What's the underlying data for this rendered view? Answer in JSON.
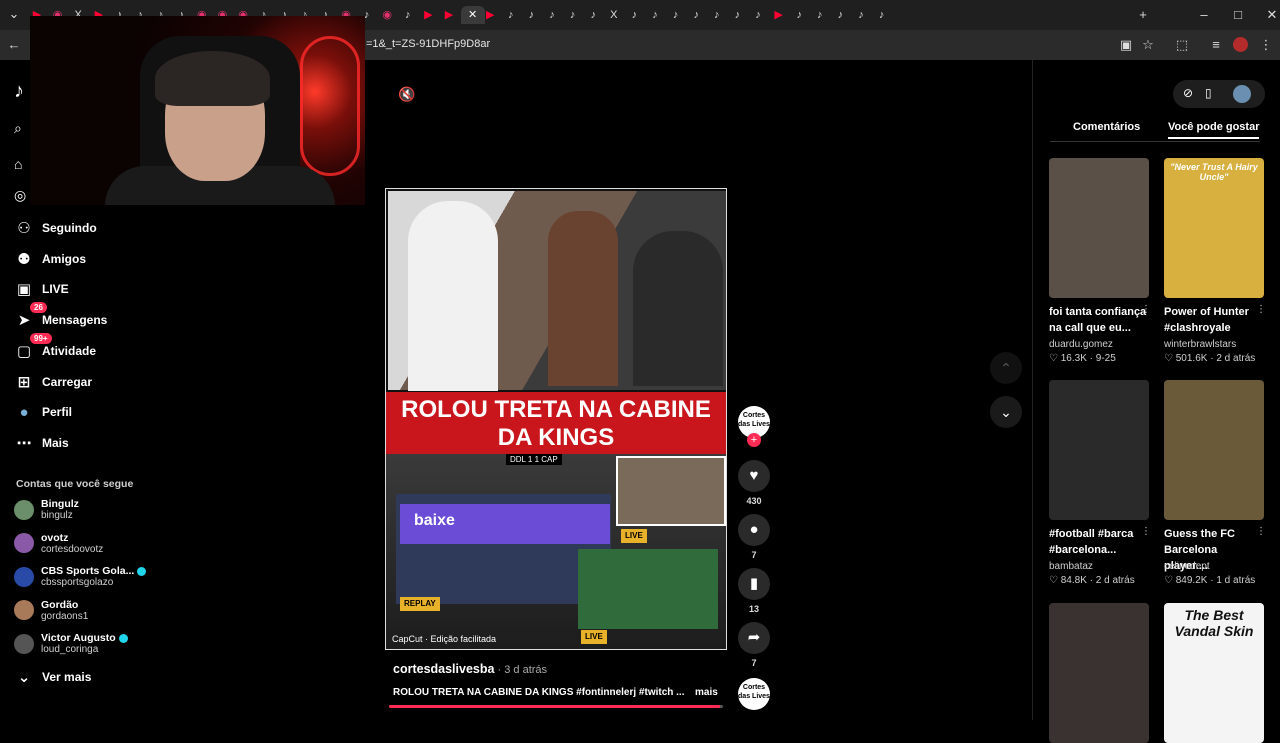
{
  "browser": {
    "url": "=1&_t=ZS-91DHFp9D8ar",
    "tab_icons": [
      "yt",
      "ig",
      "x",
      "yt",
      "tk",
      "tk",
      "tk",
      "tk",
      "ig",
      "ig",
      "ig",
      "tk",
      "tk",
      "tk",
      "tk",
      "ig",
      "tk",
      "ig",
      "tk",
      "yt",
      "yt",
      "close",
      "yt",
      "tk",
      "tk",
      "tk",
      "tk",
      "tk",
      "x",
      "tk",
      "tk",
      "tk",
      "tk",
      "tk",
      "tk",
      "tk",
      "yt",
      "tk",
      "tk",
      "tk",
      "tk",
      "tk"
    ],
    "new_tab": "+",
    "window_controls": [
      "–",
      "□",
      "✕"
    ]
  },
  "sidebar": {
    "nav": [
      {
        "icon": "person-plus",
        "label": "Seguindo"
      },
      {
        "icon": "people",
        "label": "Amigos"
      },
      {
        "icon": "live",
        "label": "LIVE"
      },
      {
        "icon": "send",
        "label": "Mensagens",
        "badge": "26"
      },
      {
        "icon": "inbox",
        "label": "Atividade",
        "badge": "99+"
      },
      {
        "icon": "plus-square",
        "label": "Carregar"
      },
      {
        "icon": "avatar",
        "label": "Perfil"
      },
      {
        "icon": "dots",
        "label": "Mais"
      }
    ],
    "following_title": "Contas que você segue",
    "accounts": [
      {
        "name": "Bingulz",
        "handle": "bingulz",
        "verified": false,
        "color": "#6a8f6a"
      },
      {
        "name": "ovotz",
        "handle": "cortesdoovotz",
        "verified": false,
        "color": "#8a5aa8"
      },
      {
        "name": "CBS Sports Gola...",
        "handle": "cbssportsgolazo",
        "verified": true,
        "color": "#2a4aa8"
      },
      {
        "name": "Gordão",
        "handle": "gordaons1",
        "verified": false,
        "color": "#a87a5a"
      },
      {
        "name": "Victor Augusto",
        "handle": "loud_coringa",
        "verified": true,
        "color": "#555"
      }
    ],
    "see_more": "Ver mais"
  },
  "video": {
    "title_overlay": "ROLOU TRETA NA CABINE DA KINGS",
    "scoreboard": "DDL 1 1 CAP",
    "ad_text": "baixe",
    "tag_live": "LIVE",
    "tag_replay": "REPLAY",
    "capcut": "CapCut · Edição facilitada",
    "author": "cortesdaslivesba",
    "time": " · 3 d atrás",
    "caption": "ROLOU TRETA NA CABINE DA KINGS #fontinnelerj #twitch ...",
    "more": "mais",
    "progress": 0.99,
    "avatar_text": "Cortes das Lives"
  },
  "actions": [
    {
      "icon": "heart",
      "count": "430"
    },
    {
      "icon": "comment",
      "count": "7"
    },
    {
      "icon": "bookmark",
      "count": "13"
    },
    {
      "icon": "share",
      "count": "7"
    }
  ],
  "right": {
    "tabs": [
      "Comentários",
      "Você pode gostar"
    ],
    "active_tab": 1,
    "cards": [
      {
        "title1": "foi tanta confiança",
        "title2": "na call que eu...",
        "user": "duardu.gomez",
        "likes": "16.3K",
        "date": "9-25",
        "bg": "#5a5048",
        "thumb_text": ""
      },
      {
        "title1": "Power of Hunter",
        "title2": "#clashroyale",
        "user": "winterbrawlstars",
        "likes": "501.6K",
        "date": "2 d atrás",
        "bg": "#d8b040",
        "thumb_text": "\"Never Trust A Hairy Uncle\""
      },
      {
        "title1": "#football #barca",
        "title2": "#barcelona...",
        "user": "bambataz",
        "likes": "84.8K",
        "date": "2 d atrás",
        "bg": "#2a2a2a",
        "thumb_text": ""
      },
      {
        "title1": "Guess the FC",
        "title2": "Barcelona player....",
        "user": "celinedept",
        "likes": "849.2K",
        "date": "1 d atrás",
        "bg": "#6a5a3a",
        "thumb_text": ""
      },
      {
        "title1": "",
        "title2": "",
        "user": "",
        "likes": "",
        "date": "",
        "bg": "#3a3230",
        "thumb_text": ""
      },
      {
        "title1": "",
        "title2": "",
        "user": "",
        "likes": "",
        "date": "",
        "bg": "#f4f4f4",
        "thumb_text": "The Best Vandal Skin"
      }
    ]
  }
}
